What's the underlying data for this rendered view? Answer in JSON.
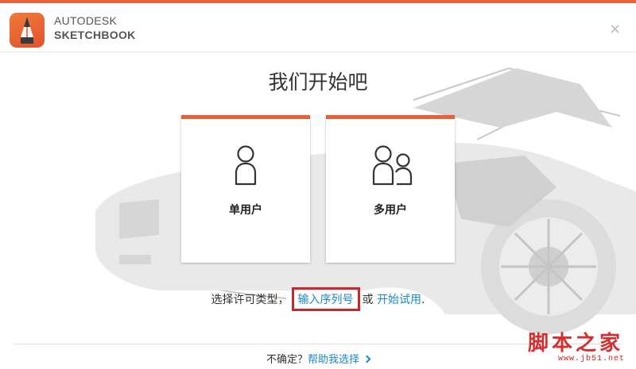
{
  "brand": {
    "line1": "AUTODESK",
    "line2": "SKETCHBOOK",
    "accent_color": "#e8603c"
  },
  "window": {
    "close_glyph": "×"
  },
  "main": {
    "title": "我们开始吧",
    "cards": [
      {
        "label": "单用户",
        "icon": "single-user-icon"
      },
      {
        "label": "多用户",
        "icon": "multi-user-icon"
      }
    ]
  },
  "license": {
    "prefix": "选择许可类型，",
    "serial_link": "输入序列号",
    "or_text": "或",
    "trial_link": "开始试用",
    "suffix": ".",
    "link_color": "#1a88c9",
    "highlight_color": "#d0242b"
  },
  "help": {
    "question": "不确定？",
    "link": "帮助我选择",
    "arrow_icon": "chevron-right-icon"
  },
  "watermark": {
    "text": "脚本之家",
    "url": "www.jb51.net"
  }
}
